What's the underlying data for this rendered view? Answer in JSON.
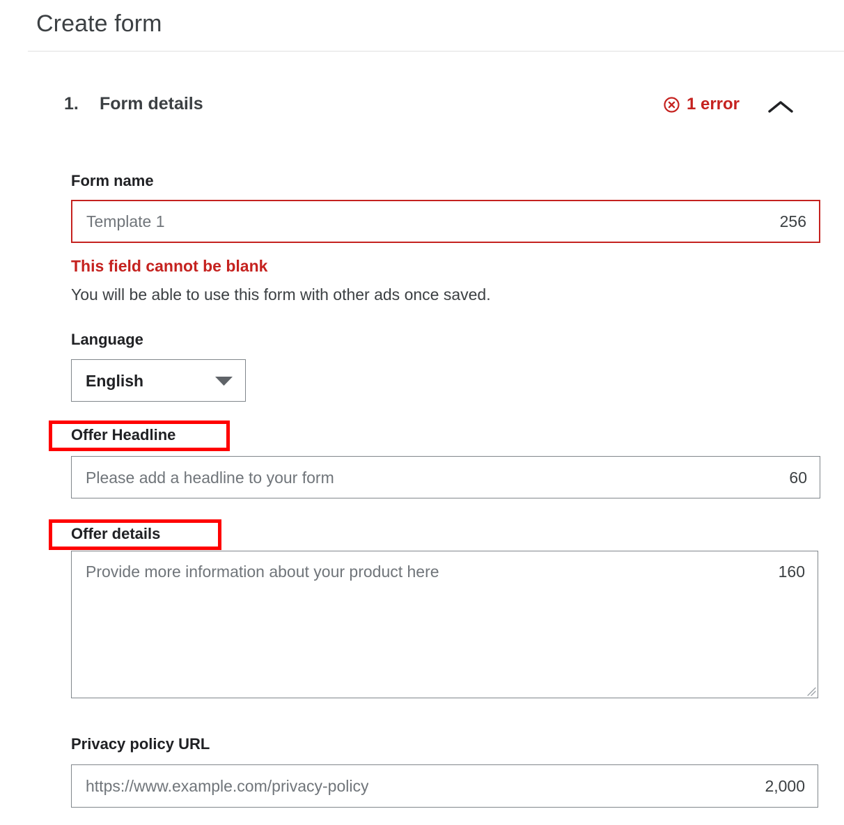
{
  "header": {
    "title": "Create form"
  },
  "section": {
    "index": "1.",
    "title": "Form details",
    "error_badge": {
      "icon": "error-circle-x-icon",
      "label": "1 error"
    },
    "collapse_icon": "chevron-up-icon"
  },
  "fields": {
    "form_name": {
      "label": "Form name",
      "placeholder": "Template 1",
      "value": "",
      "counter": "256",
      "error_message": "This field cannot be blank",
      "helper_text": "You will be able to use this form with other ads once saved."
    },
    "language": {
      "label": "Language",
      "selected": "English",
      "arrow_icon": "triangle-down-icon"
    },
    "offer_headline": {
      "label": "Offer Headline",
      "placeholder": "Please add a headline to your form",
      "value": "",
      "counter": "60"
    },
    "offer_details": {
      "label": "Offer details",
      "placeholder": "Provide more information about your product here",
      "value": "",
      "counter": "160",
      "resize_handle": "resize-grip-icon"
    },
    "privacy_policy_url": {
      "label": "Privacy policy URL",
      "placeholder": "https://www.example.com/privacy-policy",
      "value": "",
      "counter": "2,000"
    }
  },
  "annotations": {
    "color": "#ff0000",
    "targets": [
      "Offer Headline",
      "Offer details"
    ]
  },
  "colors": {
    "error": "#c5221f",
    "text": "#202124",
    "muted": "#70757a",
    "border": "#80868b",
    "annotation": "#ff0000"
  }
}
